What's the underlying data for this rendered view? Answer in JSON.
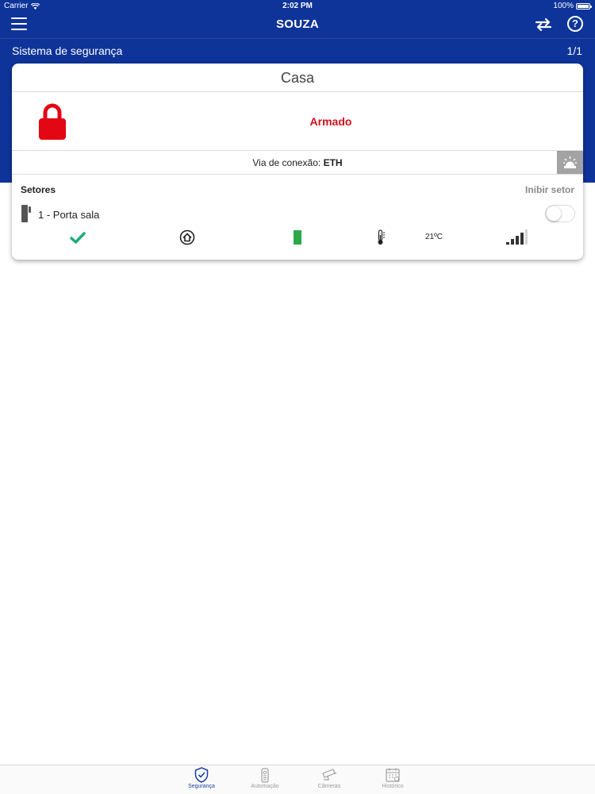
{
  "status_bar": {
    "carrier": "Carrier",
    "time": "2:02 PM",
    "battery": "100%"
  },
  "nav": {
    "title": "SOUZA",
    "help_label": "?"
  },
  "subheader": {
    "title": "Sistema de segurança",
    "pager": "1/1"
  },
  "card": {
    "title": "Casa",
    "arm_status": "Armado",
    "arm_color": "#d0111b",
    "connection_label": "Via de conexão:",
    "connection_value": "ETH"
  },
  "sectors": {
    "heading": "Setores",
    "inhibit_label": "Inibir setor",
    "items": [
      {
        "name": "1 - Porta sala",
        "temperature": "21ºC",
        "inhibited": false,
        "icons": [
          "check-icon",
          "home-icon",
          "battery-level-icon",
          "thermometer-icon",
          "signal-icon"
        ]
      }
    ]
  },
  "tabs": [
    {
      "label": "Segurança",
      "icon": "shield-check-icon",
      "active": true
    },
    {
      "label": "Automação",
      "icon": "remote-icon",
      "active": false
    },
    {
      "label": "Câmeras",
      "icon": "camera-icon",
      "active": false
    },
    {
      "label": "Histórico",
      "icon": "calendar-icon",
      "active": false
    }
  ],
  "colors": {
    "header": "#0e3499",
    "accent": "#1a3f9e",
    "ok": "#1fab74",
    "battery": "#2aa84a"
  }
}
